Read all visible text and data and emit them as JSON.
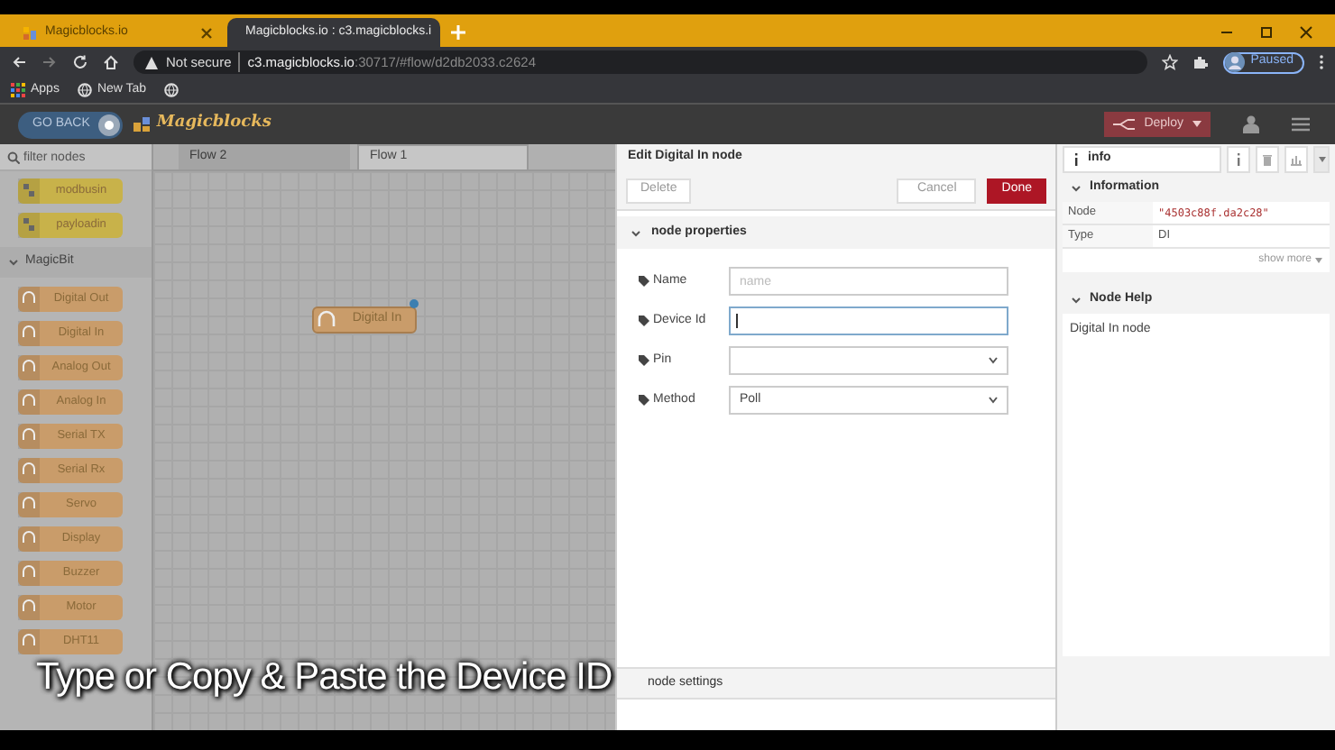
{
  "browser": {
    "tabs": [
      {
        "label": "Magicblocks.io",
        "selected": false
      },
      {
        "label": "Magicblocks.io : c3.magicblocks.i",
        "selected": true
      }
    ],
    "address": {
      "security": "Not secure",
      "host": "c3.magicblocks.io",
      "path": ":30717/#flow/d2db2033.c2624"
    },
    "profile": "Paused",
    "bookmarks": [
      "Apps",
      "New Tab"
    ]
  },
  "app_header": {
    "go_back": "GO BACK",
    "logo": "Magicblocks",
    "deploy": "Deploy"
  },
  "palette": {
    "search_placeholder": "filter nodes",
    "top_nodes": [
      "modbusin",
      "payloadin"
    ],
    "category": "MagicBit",
    "nodes": [
      "Digital Out",
      "Digital In",
      "Analog Out",
      "Analog In",
      "Serial TX",
      "Serial Rx",
      "Servo",
      "Display",
      "Buzzer",
      "Motor",
      "DHT11"
    ]
  },
  "workspace": {
    "tabs": [
      {
        "label": "Flow 2",
        "selected": false
      },
      {
        "label": "Flow 1",
        "selected": true
      }
    ],
    "node": {
      "label": "Digital In",
      "changed": true
    }
  },
  "editor": {
    "title": "Edit Digital In node",
    "buttons": {
      "delete": "Delete",
      "cancel": "Cancel",
      "done": "Done"
    },
    "section": "node properties",
    "fields": [
      {
        "label": "Name",
        "kind": "text",
        "placeholder": "name",
        "focused": false
      },
      {
        "label": "Device Id",
        "kind": "text",
        "focused": true
      },
      {
        "label": "Pin",
        "kind": "select"
      },
      {
        "label": "Method",
        "kind": "select",
        "value": "Poll"
      }
    ],
    "footer_section": "node settings"
  },
  "sidebar": {
    "tab": "info",
    "information": {
      "title": "Information",
      "rows": [
        {
          "key": "Node",
          "value": "\"4503c88f.da2c28\""
        },
        {
          "key": "Type",
          "value": "DI"
        }
      ],
      "show_more": "show more"
    },
    "help": {
      "title": "Node Help",
      "text": "Digital In node"
    }
  },
  "caption": "Type or Copy & Paste the Device ID"
}
